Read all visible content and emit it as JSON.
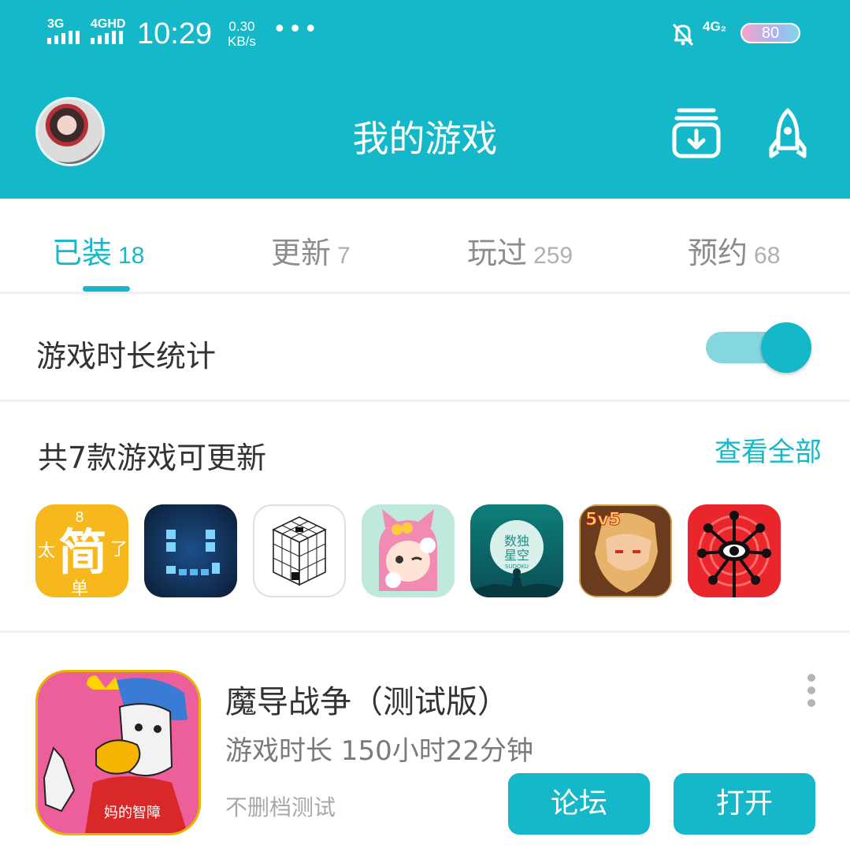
{
  "status_bar": {
    "sim1": "3G",
    "sim2": "4GHD",
    "time": "10:29",
    "speed_value": "0.30",
    "speed_unit": "KB/s",
    "more": "•••",
    "network": "4G₂",
    "battery": "80"
  },
  "header": {
    "title": "我的游戏",
    "avatar_icon": "user-avatar",
    "download_icon": "download-box-icon",
    "rocket_icon": "rocket-icon"
  },
  "tabs": [
    {
      "label": "已装",
      "count": "18",
      "active": true
    },
    {
      "label": "更新",
      "count": "7",
      "active": false
    },
    {
      "label": "玩过",
      "count": "259",
      "active": false
    },
    {
      "label": "预约",
      "count": "68",
      "active": false
    }
  ],
  "playtime_stats": {
    "label": "游戏时长统计",
    "enabled": true
  },
  "updates": {
    "title": "共7款游戏可更新",
    "view_all": "查看全部",
    "icon_names": [
      "jiandan-game-icon",
      "pixel-face-game-icon",
      "cube-puzzle-game-icon",
      "anime-cat-girl-game-icon",
      "sudoku-starry-sky-game-icon",
      "honor-of-kings-5v5-game-icon",
      "red-eye-game-icon"
    ],
    "icon_texts": {
      "jiandan": [
        "8",
        "简",
        "太",
        "了",
        "单"
      ],
      "sudoku": [
        "数独",
        "星空",
        "SUDOKU"
      ],
      "kings": "5v5"
    }
  },
  "game": {
    "name": "魔导战争（测试版）",
    "playtime": "游戏时长 150小时22分钟",
    "note": "不删档测试",
    "forum_button": "论坛",
    "open_button": "打开",
    "icon_text": "妈的智障"
  },
  "colors": {
    "primary": "#14b8c8",
    "toggle_track": "#84d6df",
    "divider": "#f0f0f0"
  }
}
